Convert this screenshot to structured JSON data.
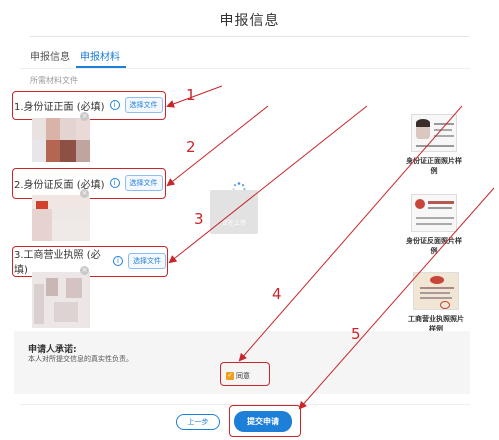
{
  "page": {
    "title": "申报信息"
  },
  "tabs": [
    {
      "label": "申报信息",
      "active": false
    },
    {
      "label": "申报材料",
      "active": true
    }
  ],
  "section_label": "所需材料文件",
  "fields": [
    {
      "label": "1.身份证正面 (必填)",
      "button": "选择文件"
    },
    {
      "label": "2.身份证反面 (必填)",
      "button": "选择文件"
    },
    {
      "label": "3.工商营业执照 (必填)",
      "button": "选择文件"
    }
  ],
  "samples": [
    {
      "label": "身份证正面照片样例"
    },
    {
      "label": "身份证反面照片样例"
    },
    {
      "label": "工商营业执照照片样例"
    }
  ],
  "annotations": [
    "1",
    "2",
    "3",
    "4",
    "5"
  ],
  "loading": {
    "text": "正在上传"
  },
  "commitment": {
    "title": "申请人承诺:",
    "text": "本人对所提交信息的真实性负责。",
    "agree_label": "同意"
  },
  "buttons": {
    "prev": "上一步",
    "submit": "提交申请"
  },
  "colors": {
    "accent": "#1e7fd9",
    "annotation": "#c9262b",
    "agree": "#f0a020"
  }
}
